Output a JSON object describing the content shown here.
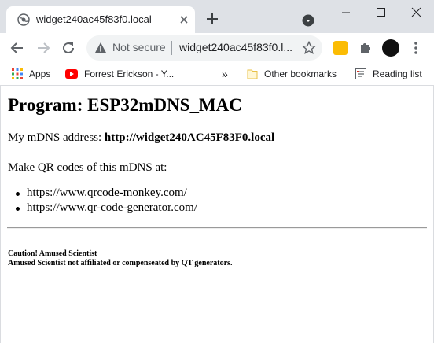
{
  "tab": {
    "title": "widget240ac45f83f0.local"
  },
  "omnibox": {
    "security_label": "Not secure",
    "url": "widget240ac45f83f0.l..."
  },
  "bookmarks": {
    "apps": "Apps",
    "forrest": "Forrest Erickson - Y...",
    "overflow": "»",
    "other": "Other bookmarks",
    "reading": "Reading list"
  },
  "page": {
    "heading": "Program: ESP32mDNS_MAC",
    "mdns_prefix": "My mDNS address: ",
    "mdns_address": "http://widget240AC45F83F0.local",
    "qr_text": "Make QR codes of this mDNS at:",
    "links": [
      "https://www.qrcode-monkey.com/",
      "https://www.qr-code-generator.com/"
    ],
    "caution_line1": "Caution! Amused Scientist",
    "caution_line2": "Amused Scientist not affiliated or compenseated by QT generators."
  }
}
